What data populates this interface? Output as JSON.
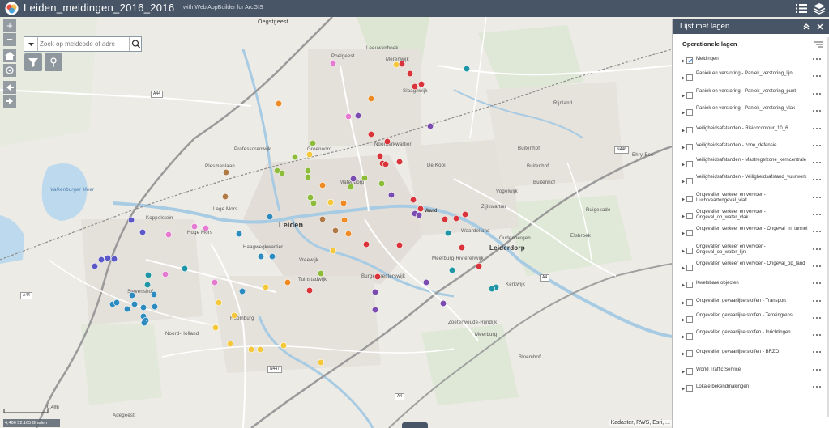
{
  "header": {
    "title": "Leiden_meldingen_2016_2016",
    "subtitle": "with Web AppBuilder for ArcGIS"
  },
  "search": {
    "placeholder": "Zoek op meldcode of adre"
  },
  "map": {
    "zoom_in": "+",
    "zoom_out": "−",
    "scale_label": "0.4mi",
    "coordinates": "4,466 52.165 Graden",
    "attribution": "Kadaster, RWS, Esri, ...",
    "places": [
      {
        "name": "Oegstgeest"
      },
      {
        "name": "Poelgeest"
      },
      {
        "name": "Leeuwenhoek"
      },
      {
        "name": "Merenwijk"
      },
      {
        "name": "Slaaghwijk"
      },
      {
        "name": "De Kooi"
      },
      {
        "name": "Groenoord"
      },
      {
        "name": "Noorderkwartier"
      },
      {
        "name": "Professorenwijk"
      },
      {
        "name": "Plesmanlaan"
      },
      {
        "name": "Valkenburger Meer"
      },
      {
        "name": "Lage Mors"
      },
      {
        "name": "Koppelstein"
      },
      {
        "name": "Hoge Mors"
      },
      {
        "name": "Leiden"
      },
      {
        "name": "Haagwegkwartier"
      },
      {
        "name": "Vreewijk"
      },
      {
        "name": "Tuinstadwijk"
      },
      {
        "name": "Burgemeesterswijk"
      },
      {
        "name": "Stevenshof"
      },
      {
        "name": "Roomburg"
      },
      {
        "name": "Noord-Holland"
      },
      {
        "name": "Meerburg-Rivierenwijk"
      },
      {
        "name": "Zijlkwartier"
      },
      {
        "name": "Ward"
      },
      {
        "name": "Waardeiland"
      },
      {
        "name": "Oudenbergen"
      },
      {
        "name": "Leiderdorp"
      },
      {
        "name": "Vogelwijk"
      },
      {
        "name": "Buitenhof"
      },
      {
        "name": "Ruigekade"
      },
      {
        "name": "Elsbroek"
      },
      {
        "name": "Kerkwijk"
      },
      {
        "name": "Zoeterwoude-Rijndijk"
      },
      {
        "name": "Meerburg"
      },
      {
        "name": "Bloemhof"
      },
      {
        "name": "Adegeest"
      },
      {
        "name": "Rijnland"
      },
      {
        "name": "Ehry-Bos"
      },
      {
        "name": "Matendorp"
      },
      {
        "name": "Buitenhof"
      },
      {
        "name": "Buitenhof"
      }
    ],
    "road_shields": [
      "A44",
      "A44",
      "A4",
      "A4",
      "N447",
      "N446"
    ],
    "incident_colors": {
      "red": "#d8343a",
      "orange": "#ef8b24",
      "yellow": "#f4c83a",
      "green": "#8dbb3a",
      "teal": "#1f95a6",
      "blue": "#2e8bbf",
      "purple": "#7b4bb0",
      "pink": "#e57bd0",
      "brown": "#b07a46",
      "indigo": "#5d58c8"
    }
  },
  "panel": {
    "title": "Lijst met lagen",
    "section_title": "Operationele lagen",
    "layers": [
      {
        "label": "Meldingen",
        "checked": true
      },
      {
        "label": "Paniek en verstoring - Paniek_verstoring_lijn",
        "checked": false
      },
      {
        "label": "Paniek en verstoring - Paniek_verstoring_punt",
        "checked": false
      },
      {
        "label": "Paniek en verstoring - Paniek_verstoring_vlak",
        "checked": false
      },
      {
        "label": "Veiligheidsafstanden - Risicocontour_10_6",
        "checked": false
      },
      {
        "label": "Veiligheidsafstanden - zone_defensie",
        "checked": false
      },
      {
        "label": "Veiligheidsafstanden - Mastregelzone_kerncentrale",
        "checked": false
      },
      {
        "label": "Veiligheidsafstanden - Veiligheidsafstand_vuurwerk",
        "checked": false
      },
      {
        "label": "Ongevallen verkeer en vervoer - Luchtvaartongeval_vlak",
        "checked": false
      },
      {
        "label": "Ongevallen verkeer en vervoer - Ongeval_op_water_vlak",
        "checked": false
      },
      {
        "label": "Ongevallen verkeer en vervoer - Ongeval_in_tunnel",
        "checked": false
      },
      {
        "label": "Ongevallen verkeer en vervoer - Ongeval_op_water_lijn",
        "checked": false
      },
      {
        "label": "Ongevallen verkeer en vervoer - Ongeval_op_land",
        "checked": false
      },
      {
        "label": "Kwetsbare objecten",
        "checked": false
      },
      {
        "label": "Ongevallen gevaarlijke stoffen - Transport",
        "checked": false
      },
      {
        "label": "Ongevallen gevaarlijke stoffen - Terreingrens",
        "checked": false
      },
      {
        "label": "Ongevallen gevaarlijke stoffen - Inrichtingen",
        "checked": false
      },
      {
        "label": "Ongevallen gevaarlijke stoffen - BRZO",
        "checked": false
      },
      {
        "label": "World Traffic Service",
        "checked": false
      },
      {
        "label": "Lokale bekendmakingen",
        "checked": false
      }
    ]
  }
}
